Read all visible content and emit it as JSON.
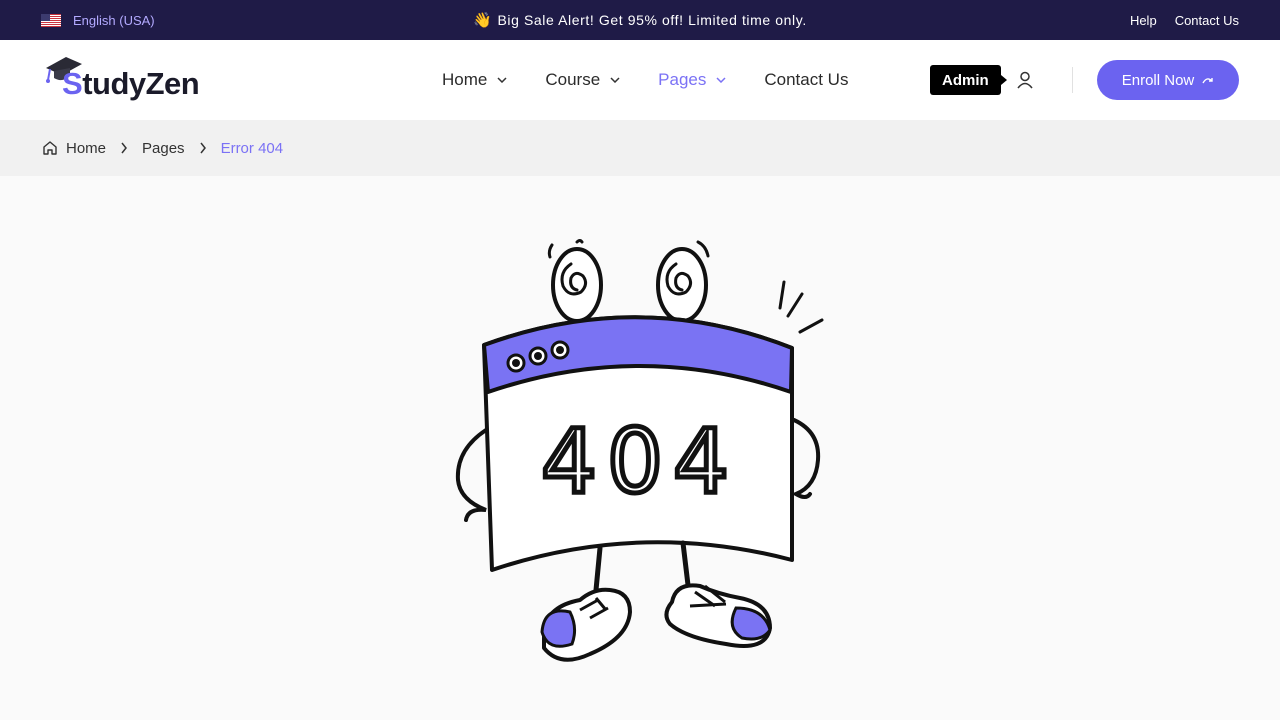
{
  "topbar": {
    "language": "English (USA)",
    "promo_emoji": "👋",
    "promo_text": "Big Sale Alert! Get 95% off! Limited time only.",
    "links": {
      "help": "Help",
      "contact": "Contact Us"
    }
  },
  "header": {
    "logo": {
      "part1": "S",
      "part2": "tudyZen"
    },
    "nav": {
      "home": "Home",
      "course": "Course",
      "pages": "Pages",
      "contact": "Contact Us"
    },
    "admin_tooltip": "Admin",
    "enroll_label": "Enroll Now"
  },
  "breadcrumb": {
    "home": "Home",
    "pages": "Pages",
    "current": "Error 404"
  },
  "illustration": {
    "text": "404"
  },
  "colors": {
    "accent": "#6b63f0",
    "topbar_bg": "#1f1b47",
    "illustration_purple": "#7a73f3"
  }
}
